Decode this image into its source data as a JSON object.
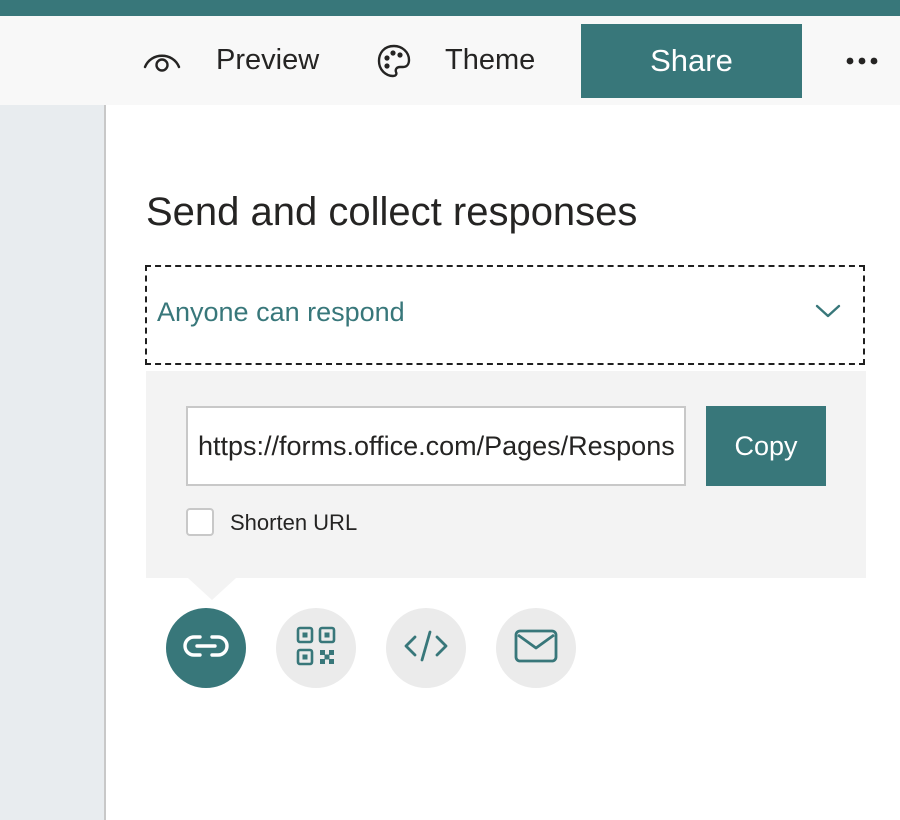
{
  "toolbar": {
    "preview_label": "Preview",
    "theme_label": "Theme",
    "share_label": "Share",
    "more_icon": "more-horizontal-icon"
  },
  "share_panel": {
    "title": "Send and collect responses",
    "audience": "Anyone can respond",
    "url": "https://forms.office.com/Pages/ResponsePage.aspx",
    "copy_label": "Copy",
    "shorten_label": "Shorten URL",
    "shorten_checked": false,
    "share_methods": [
      {
        "name": "link",
        "icon": "link-icon",
        "selected": true
      },
      {
        "name": "qr-code",
        "icon": "qr-code-icon",
        "selected": false
      },
      {
        "name": "embed",
        "icon": "code-icon",
        "selected": false
      },
      {
        "name": "email",
        "icon": "mail-icon",
        "selected": false
      }
    ]
  },
  "colors": {
    "accent": "#38777a",
    "panel_bg": "#f3f3f3",
    "sidebar_bg": "#e8ecef"
  }
}
